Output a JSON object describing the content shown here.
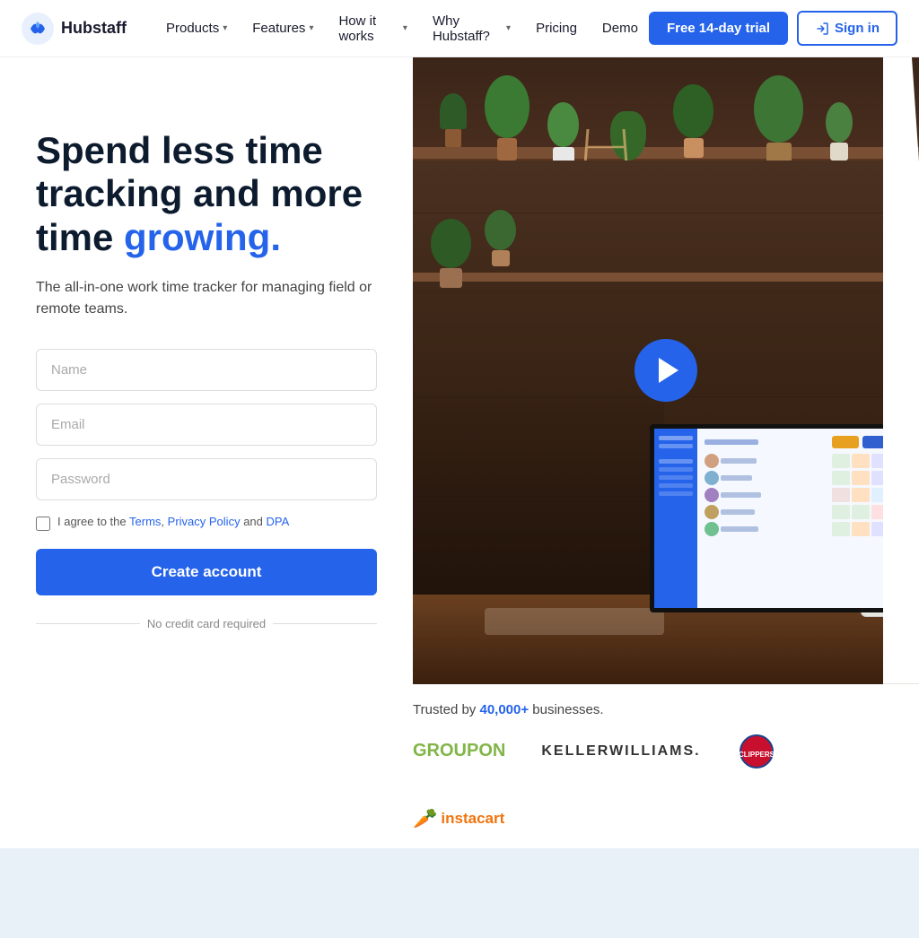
{
  "nav": {
    "logo_text": "Hubstaff",
    "links": [
      {
        "label": "Products",
        "has_dropdown": true
      },
      {
        "label": "Features",
        "has_dropdown": true
      },
      {
        "label": "How it works",
        "has_dropdown": true
      },
      {
        "label": "Why Hubstaff?",
        "has_dropdown": true
      },
      {
        "label": "Pricing",
        "has_dropdown": false
      },
      {
        "label": "Demo",
        "has_dropdown": false
      }
    ],
    "btn_trial": "Free 14-day trial",
    "btn_signin": "Sign in"
  },
  "hero": {
    "title_line1": "Spend less time",
    "title_line2": "tracking and more",
    "title_line3_plain": "time ",
    "title_line3_highlight": "growing.",
    "subtitle": "The all-in-one work time tracker for managing field or remote teams.",
    "form": {
      "name_placeholder": "Name",
      "email_placeholder": "Email",
      "password_placeholder": "Password",
      "terms_text": "I agree to the",
      "terms_link1": "Terms",
      "terms_comma": ",",
      "terms_link2": "Privacy Policy",
      "terms_and": "and",
      "terms_link3": "DPA",
      "create_btn": "Create account",
      "no_credit": "No credit card required"
    }
  },
  "trusted": {
    "text_prefix": "Trusted by ",
    "count": "40,000+",
    "text_suffix": " businesses.",
    "logos": [
      {
        "name": "groupon",
        "text": "GROUPON"
      },
      {
        "name": "keller-williams",
        "text": "KELLERWILLIAMS."
      },
      {
        "name": "clippers",
        "text": "Clippers"
      },
      {
        "name": "instacart",
        "text": "instacart"
      }
    ]
  }
}
